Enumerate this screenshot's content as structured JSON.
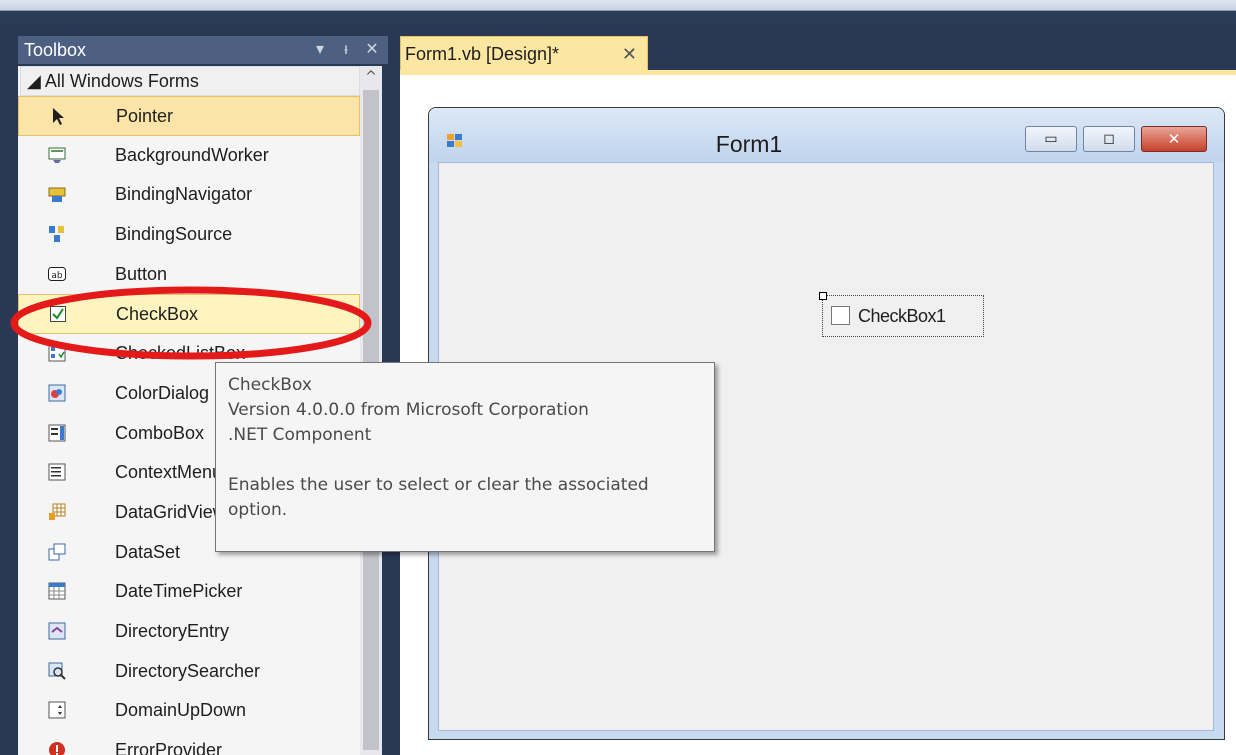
{
  "toolbox": {
    "title": "Toolbox",
    "dropdown_glyph": "▾",
    "pin_glyph": "ᵼ",
    "close_glyph": "✕",
    "scroll_up_glyph": "^",
    "category_label": "◢ All Windows Forms",
    "items": [
      {
        "label": "Pointer",
        "icon": "pointer-arrow-icon",
        "state": "selected"
      },
      {
        "label": "BackgroundWorker",
        "icon": "background-worker-icon"
      },
      {
        "label": "BindingNavigator",
        "icon": "binding-navigator-icon"
      },
      {
        "label": "BindingSource",
        "icon": "binding-source-icon"
      },
      {
        "label": "Button",
        "icon": "button-ab-icon"
      },
      {
        "label": "CheckBox",
        "icon": "checkbox-icon",
        "state": "hover"
      },
      {
        "label": "CheckedListBox",
        "icon": "checked-listbox-icon"
      },
      {
        "label": "ColorDialog",
        "icon": "color-dialog-icon"
      },
      {
        "label": "ComboBox",
        "icon": "combobox-icon"
      },
      {
        "label": "ContextMenuStrip",
        "icon": "context-menu-icon"
      },
      {
        "label": "DataGridView",
        "icon": "data-grid-icon"
      },
      {
        "label": "DataSet",
        "icon": "dataset-icon"
      },
      {
        "label": "DateTimePicker",
        "icon": "date-time-picker-icon"
      },
      {
        "label": "DirectoryEntry",
        "icon": "directory-entry-icon"
      },
      {
        "label": "DirectorySearcher",
        "icon": "directory-searcher-icon"
      },
      {
        "label": "DomainUpDown",
        "icon": "domain-updown-icon"
      },
      {
        "label": "ErrorProvider",
        "icon": "error-provider-icon"
      }
    ]
  },
  "document_tab": {
    "label": "Form1.vb [Design]*",
    "close_glyph": "✕"
  },
  "form": {
    "title": "Form1",
    "min_glyph": "▭",
    "max_glyph": "◻",
    "close_glyph": "✕",
    "checkbox_text": "CheckBox1"
  },
  "tooltip": {
    "name": "CheckBox",
    "version": "Version 4.0.0.0 from Microsoft Corporation",
    "kind": ".NET Component",
    "description_line1": "Enables the user to select or clear the associated",
    "description_line2": "option."
  },
  "colors": {
    "ide_background": "#293955",
    "toolbox_header": "#4d6082",
    "selected_item": "#fce4a8",
    "annotation_red": "#e41a1a"
  }
}
